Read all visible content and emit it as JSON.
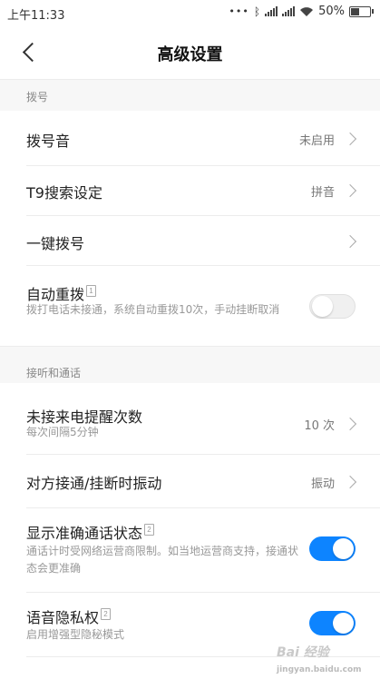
{
  "status_bar": {
    "time": "上午11:33",
    "battery": "50%",
    "battery_level": 0.5
  },
  "header": {
    "title": "高级设置"
  },
  "sections": {
    "dial": "拨号",
    "answer_call": "接听和通话"
  },
  "rows": {
    "dial_tone": {
      "label": "拨号音",
      "value": "未启用"
    },
    "t9": {
      "label": "T9搜索设定",
      "value": "拼音"
    },
    "speed_dial": {
      "label": "一键拨号"
    },
    "auto_redial": {
      "label": "自动重拨",
      "badge": "1",
      "desc": "拨打电话未接通，系统自动重拨10次，手动挂断取消",
      "enabled": false
    },
    "missed_reminder": {
      "label": "未接来电提醒次数",
      "desc": "每次间隔5分钟",
      "value": "10 次"
    },
    "vibrate": {
      "label": "对方接通/挂断时振动",
      "value": "振动"
    },
    "accurate_status": {
      "label": "显示准确通话状态",
      "badge": "2",
      "desc": "通话计时受网络运营商限制。如当地运营商支持，接通状态会更准确",
      "enabled": true
    },
    "voice_privacy": {
      "label": "语音隐私权",
      "badge": "2",
      "desc": "启用增强型隐秘模式",
      "enabled": true
    }
  },
  "watermark": {
    "text": "Bai 经验",
    "sub": "jingyan.baidu.com"
  },
  "colors": {
    "accent": "#0d84ff",
    "section_bg": "#f7f7f7"
  }
}
